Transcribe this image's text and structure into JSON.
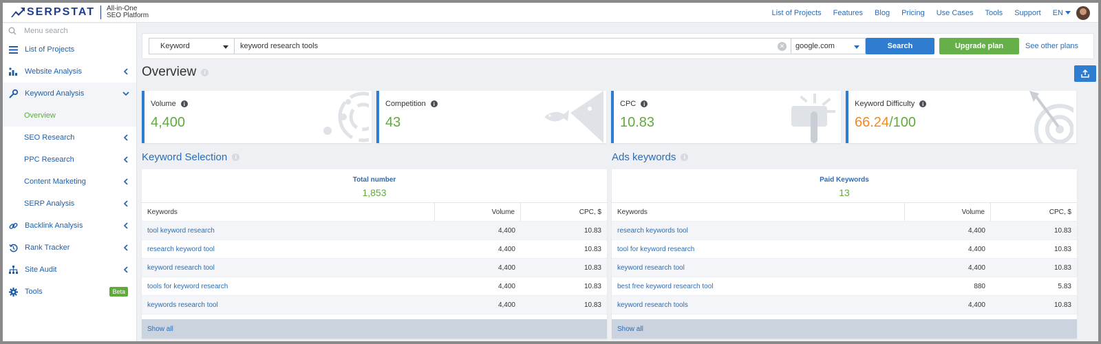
{
  "brand": {
    "name": "SERPSTAT",
    "tagline_line1": "All-in-One",
    "tagline_line2": "SEO Platform",
    "brand_color": "#1f3f8e"
  },
  "topnav": {
    "items": [
      "List of Projects",
      "Features",
      "Blog",
      "Pricing",
      "Use Cases",
      "Tools",
      "Support"
    ],
    "language": "EN"
  },
  "sidebar": {
    "search_placeholder": "Menu search",
    "items": [
      {
        "label": "List of Projects",
        "icon": "list-icon"
      },
      {
        "label": "Website Analysis",
        "icon": "bar-chart-icon"
      },
      {
        "label": "Keyword Analysis",
        "icon": "key-icon",
        "expanded": true
      },
      {
        "label": "Backlink Analysis",
        "icon": "link-icon"
      },
      {
        "label": "Rank Tracker",
        "icon": "history-icon"
      },
      {
        "label": "Site Audit",
        "icon": "sitemap-icon"
      },
      {
        "label": "Tools",
        "icon": "gear-icon",
        "badge": "Beta"
      }
    ],
    "sub_items": [
      "Overview",
      "SEO Research",
      "PPC Research",
      "Content Marketing",
      "SERP Analysis"
    ]
  },
  "search": {
    "type": "Keyword",
    "query": "keyword research tools",
    "database": "google.com",
    "search_label": "Search",
    "upgrade_label": "Upgrade plan",
    "other_plans_label": "See other plans"
  },
  "overview": {
    "title": "Overview",
    "cards": [
      {
        "label": "Volume",
        "value": "4,400"
      },
      {
        "label": "Competition",
        "value": "43"
      },
      {
        "label": "CPC",
        "value": "10.83"
      },
      {
        "label": "Keyword Difficulty",
        "value": "66.24",
        "suffix": "/100"
      }
    ]
  },
  "keyword_selection": {
    "title": "Keyword Selection",
    "total_label": "Total number",
    "total_value": "1,853",
    "columns": [
      "Keywords",
      "Volume",
      "CPC, $"
    ],
    "rows": [
      [
        "tool keyword research",
        "4,400",
        "10.83"
      ],
      [
        "research keyword tool",
        "4,400",
        "10.83"
      ],
      [
        "keyword research tool",
        "4,400",
        "10.83"
      ],
      [
        "tools for keyword research",
        "4,400",
        "10.83"
      ],
      [
        "keywords research tool",
        "4,400",
        "10.83"
      ]
    ],
    "show_all": "Show all"
  },
  "ads_keywords": {
    "title": "Ads keywords",
    "total_label": "Paid Keywords",
    "total_value": "13",
    "columns": [
      "Keywords",
      "Volume",
      "CPC, $"
    ],
    "rows": [
      [
        "research keywords tool",
        "4,400",
        "10.83"
      ],
      [
        "tool for keyword research",
        "4,400",
        "10.83"
      ],
      [
        "keyword research tool",
        "4,400",
        "10.83"
      ],
      [
        "best free keyword research tool",
        "880",
        "5.83"
      ],
      [
        "keyword research tools",
        "4,400",
        "10.83"
      ]
    ],
    "show_all": "Show all"
  },
  "colors": {
    "accent_blue": "#2e7dd1",
    "link_blue": "#2b6cb5",
    "green": "#5fab3a",
    "orange": "#f08a24"
  }
}
